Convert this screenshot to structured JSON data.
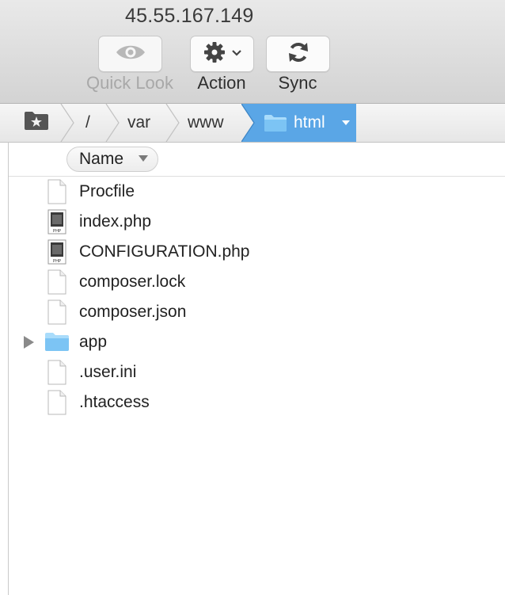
{
  "window": {
    "title": "45.55.167.149"
  },
  "toolbar": {
    "quick_look_label": "Quick Look",
    "action_label": "Action",
    "sync_label": "Sync"
  },
  "path": {
    "root_icon": "favorites-folder-icon",
    "segments": [
      "/",
      "var",
      "www"
    ],
    "current": "html"
  },
  "columns": {
    "name_label": "Name"
  },
  "files": [
    {
      "name": "Procfile",
      "kind": "document-icon"
    },
    {
      "name": "index.php",
      "kind": "php-file-icon"
    },
    {
      "name": "CONFIGURATION.php",
      "kind": "php-file-icon"
    },
    {
      "name": "composer.lock",
      "kind": "document-icon"
    },
    {
      "name": "composer.json",
      "kind": "document-icon"
    },
    {
      "name": "app",
      "kind": "folder-icon",
      "expandable": true
    },
    {
      "name": ".user.ini",
      "kind": "document-icon"
    },
    {
      "name": ".htaccess",
      "kind": "document-icon"
    }
  ],
  "colors": {
    "accent": "#5aa6e6",
    "folder": "#7cc4f4"
  }
}
